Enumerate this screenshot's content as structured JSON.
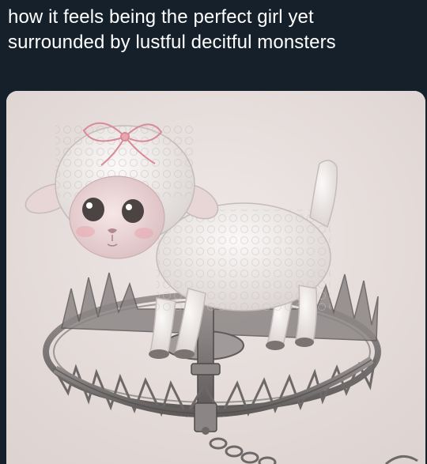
{
  "post": {
    "text_lines": [
      "how it feels being the perfect girl yet",
      "surrounded by lustful decitful monsters"
    ]
  },
  "media": {
    "subject": "lamb-standing-in-bear-trap",
    "colors": {
      "background": "#15202b",
      "text": "#ffffff",
      "paper": "#e9e1df",
      "wool": "#f4f0ee",
      "bow": "#e8a6b2",
      "trap_metal": "#7b7776"
    }
  }
}
